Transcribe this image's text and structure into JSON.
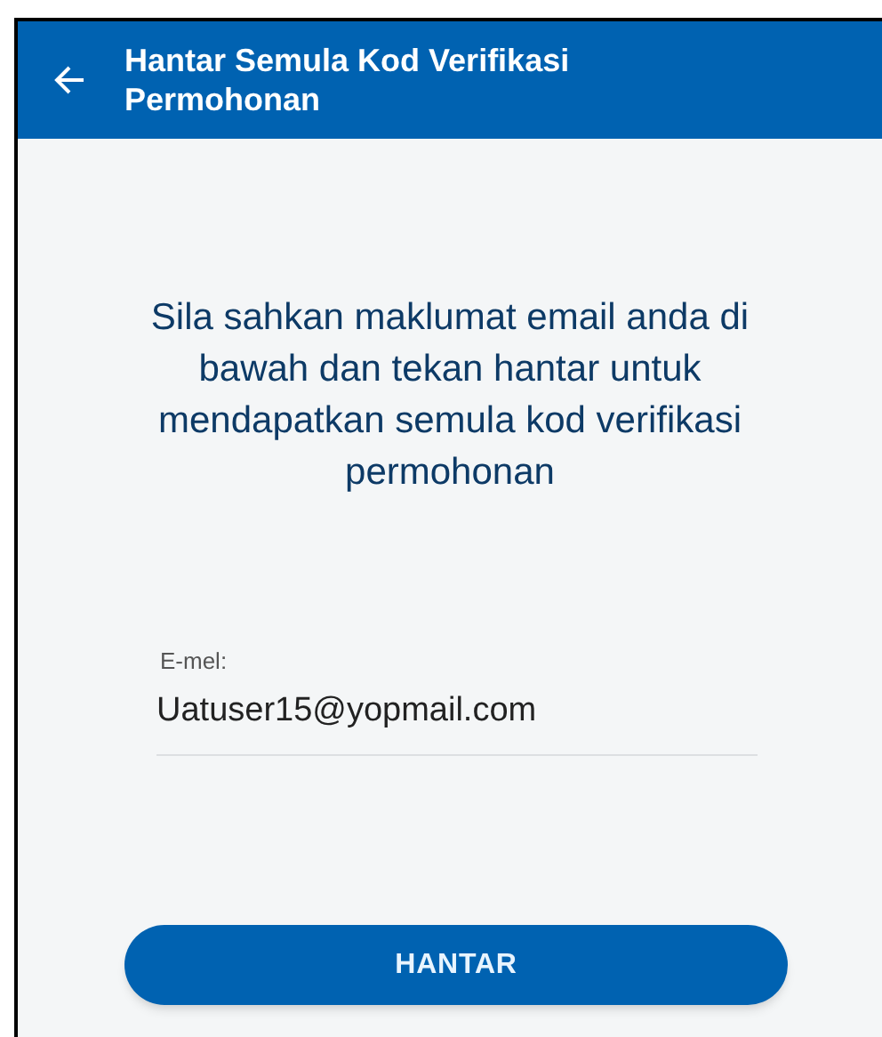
{
  "header": {
    "title": "Hantar Semula Kod Verifikasi Permohonan"
  },
  "message": "Sila sahkan maklumat email anda di bawah dan tekan hantar untuk mendapatkan semula kod verifikasi permohonan",
  "email_field": {
    "label": "E-mel:",
    "value": "Uatuser15@yopmail.com"
  },
  "submit_button": "HANTAR"
}
